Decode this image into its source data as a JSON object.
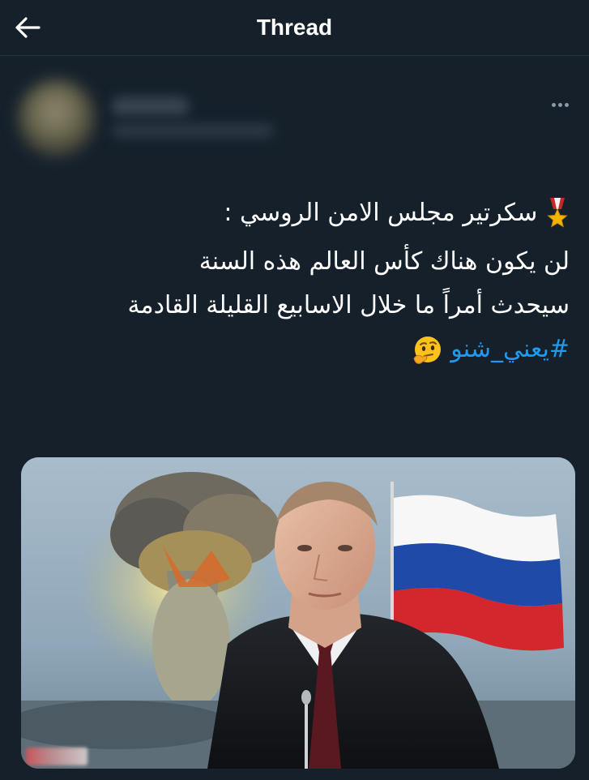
{
  "header": {
    "title": "Thread",
    "back_icon": "arrow-left-icon"
  },
  "author": {
    "avatar": "blurred-avatar",
    "more_icon": "more-horizontal-icon"
  },
  "tweet": {
    "line1": "سكرتير مجلس الامن الروسي :",
    "line1_icon": "military-medal-icon",
    "line2": "لن يكون هناك كأس العالم هذه السنة",
    "line3": "سيحدث أمراً ما خلال الاسابيع القليلة القادمة",
    "hashtag": "#يعني_شنو",
    "hashtag_icon": "thinking-face-icon"
  },
  "media": {
    "description_icon": "photo-putin-flag-explosion",
    "flag_colors": [
      "#ffffff",
      "#1f4aa8",
      "#d3262d"
    ]
  },
  "colors": {
    "background": "#15202b",
    "text": "#ffffff",
    "link": "#1d9bf0",
    "muted": "#8b98a5"
  }
}
